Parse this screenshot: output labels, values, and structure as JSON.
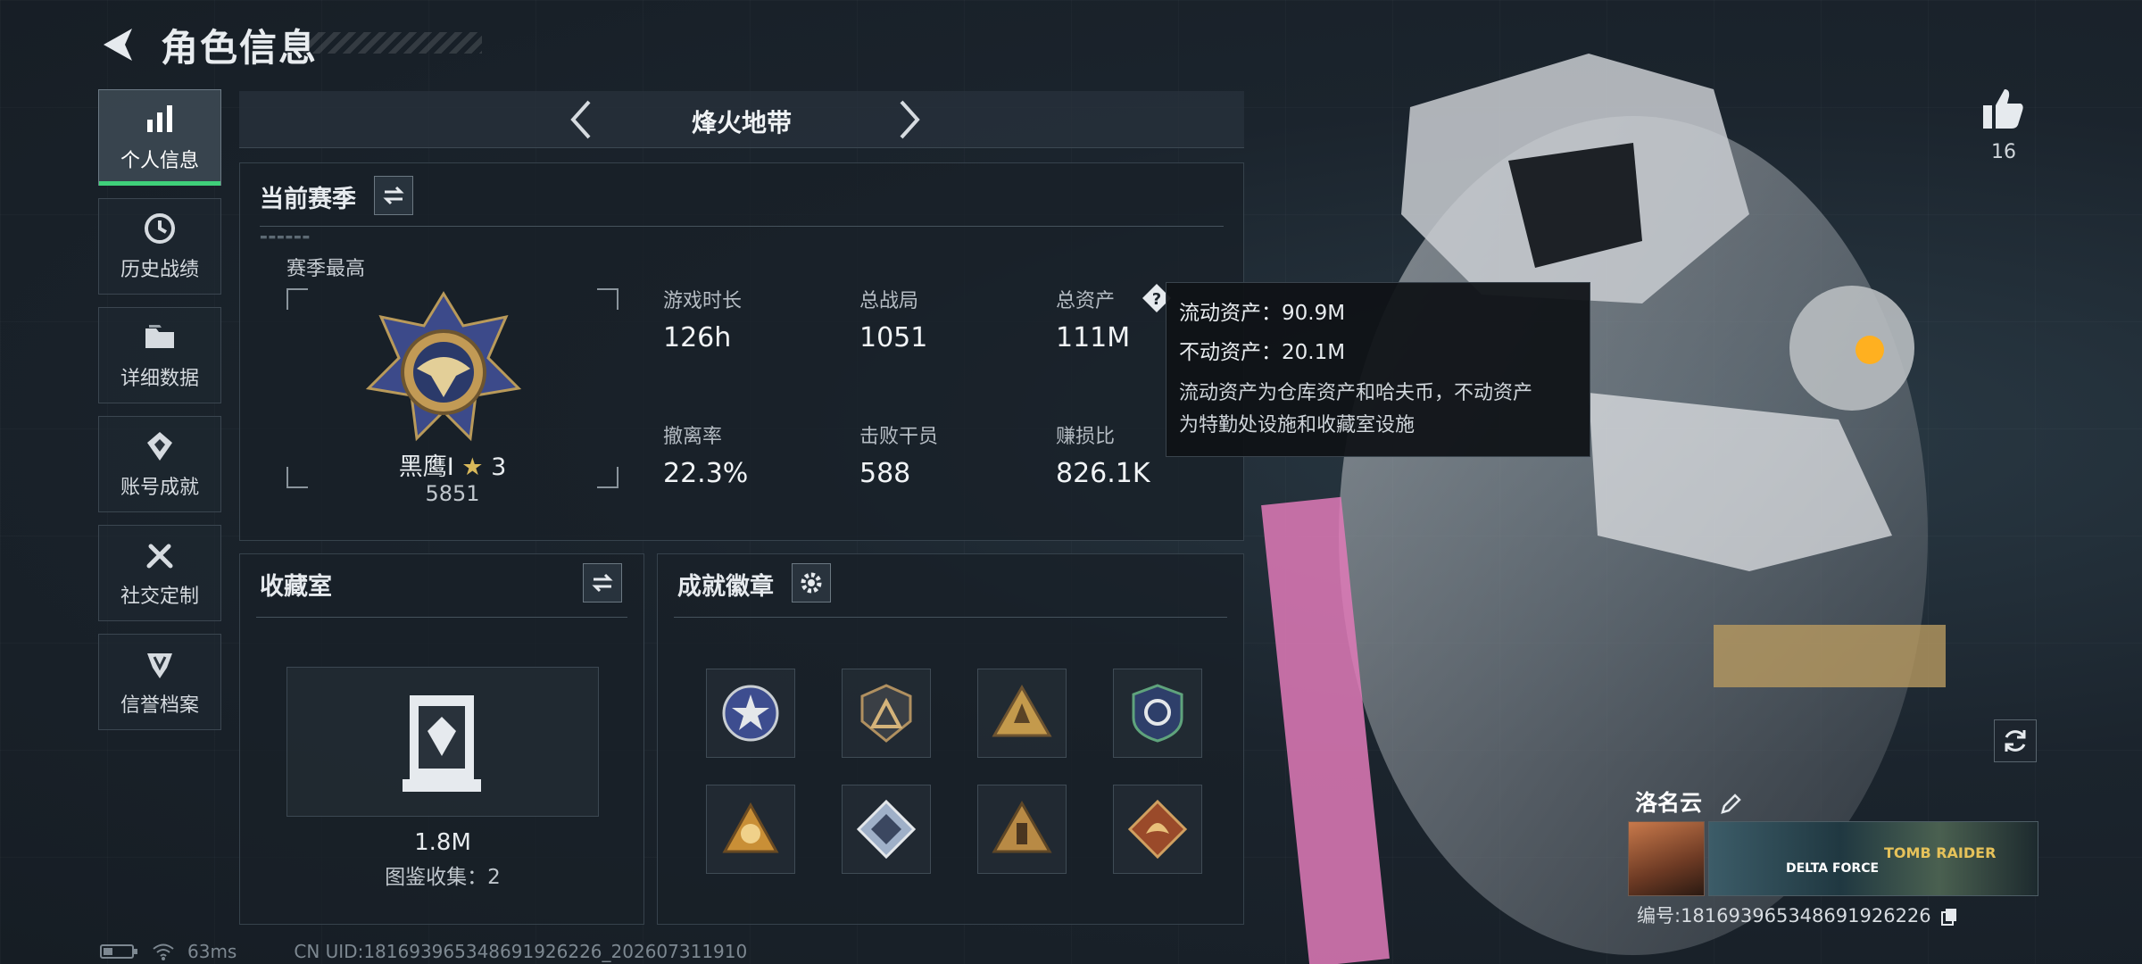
{
  "header": {
    "title": "角色信息"
  },
  "sidebar": {
    "items": [
      {
        "label": "个人信息",
        "icon": "bar-chart-icon"
      },
      {
        "label": "历史战绩",
        "icon": "history-clock-icon"
      },
      {
        "label": "详细数据",
        "icon": "folder-icon"
      },
      {
        "label": "账号成就",
        "icon": "achievement-icon"
      },
      {
        "label": "社交定制",
        "icon": "tools-icon"
      },
      {
        "label": "信誉档案",
        "icon": "reputation-icon"
      }
    ]
  },
  "mode": {
    "name": "烽火地带"
  },
  "season": {
    "title": "当前赛季",
    "best_label": "赛季最高",
    "rank_name": "黑鹰I",
    "rank_stars": "3",
    "rank_score": "5851",
    "stats": [
      {
        "label": "游戏时长",
        "value": "126h"
      },
      {
        "label": "总战局",
        "value": "1051"
      },
      {
        "label": "总资产",
        "value": "111M"
      },
      {
        "label": "撤离率",
        "value": "22.3%"
      },
      {
        "label": "击败干员",
        "value": "588"
      },
      {
        "label": "赚损比",
        "value": "826.1K"
      }
    ]
  },
  "tooltip": {
    "liquid": "流动资产：90.9M",
    "fixed": "不动资产：20.1M",
    "desc1": "流动资产为仓库资产和哈夫币，不动资产",
    "desc2": "为特勤处设施和收藏室设施"
  },
  "collection": {
    "title": "收藏室",
    "value": "1.8M",
    "caption": "图鉴收集：2"
  },
  "badges": {
    "title": "成就徽章"
  },
  "profile": {
    "likes": "16",
    "name": "洛名云",
    "id_line": "编号:1816939653486919262​26",
    "banner_text1": "DELTA FORCE",
    "banner_text2": "TOMB RAIDER"
  },
  "status": {
    "ping": "63ms",
    "uid": "CN UID:1816939653486919262​26_202607311910"
  },
  "colors": {
    "accent": "#3fd07a",
    "panel": "#18202a"
  }
}
